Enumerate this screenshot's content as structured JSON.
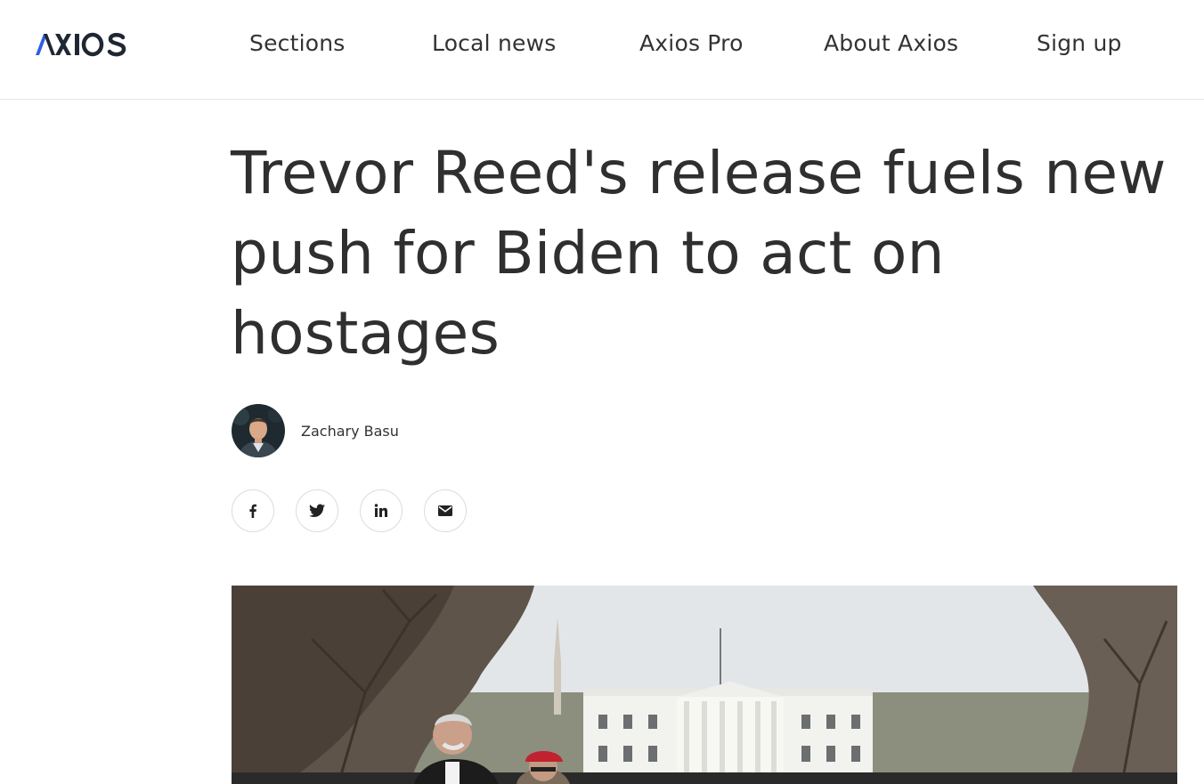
{
  "brand": {
    "logo_text": "AXIOS",
    "accent_color": "#2f5fe0"
  },
  "nav": {
    "items": [
      {
        "label": "Sections"
      },
      {
        "label": "Local news"
      },
      {
        "label": "Axios Pro"
      },
      {
        "label": "About Axios"
      },
      {
        "label": "Sign up"
      }
    ]
  },
  "article": {
    "headline": "Trevor Reed's release fuels new push for Biden to act on hostages",
    "author": "Zachary Basu",
    "share": [
      {
        "icon": "facebook-icon",
        "glyph": "f"
      },
      {
        "icon": "twitter-icon",
        "glyph": "twitter"
      },
      {
        "icon": "linkedin-icon",
        "glyph": "in"
      },
      {
        "icon": "email-icon",
        "glyph": "mail"
      }
    ]
  }
}
